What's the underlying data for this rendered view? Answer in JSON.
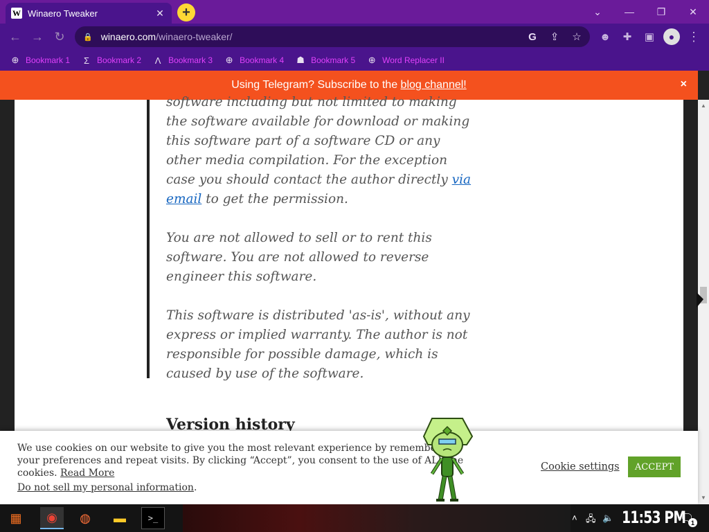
{
  "browser": {
    "tab": {
      "favicon": "W",
      "title": "Winaero Tweaker",
      "close": "✕"
    },
    "new_tab": "+",
    "window_controls": {
      "tab_search": "⌄",
      "minimize": "—",
      "restore": "❐",
      "close": "✕"
    },
    "nav": {
      "back": "←",
      "forward": "→",
      "reload": "↻"
    },
    "address": {
      "lock": "🔒",
      "host": "winaero.com",
      "path": "/winaero-tweaker/"
    },
    "omni_icons": {
      "google": "G",
      "share": "⇪",
      "bookmark": "☆"
    },
    "toolbar_icons": {
      "extension_avatar": "☻",
      "extensions": "✚",
      "side_panel": "▣",
      "profile": "●",
      "menu": "⋮"
    }
  },
  "bookmarks": [
    {
      "label": "Bookmark 1",
      "icon": "⊕"
    },
    {
      "label": "Bookmark 2",
      "icon": "Σ"
    },
    {
      "label": "Bookmark 3",
      "icon": "Λ"
    },
    {
      "label": "Bookmark 4",
      "icon": "⊕"
    },
    {
      "label": "Bookmark 5",
      "icon": "☗"
    },
    {
      "label": "Word Replacer II",
      "icon": "⊕"
    }
  ],
  "banner": {
    "text": "Using Telegram? Subscribe to the ",
    "link": "blog channel!",
    "close": "×",
    "color": "#f4511e"
  },
  "article": {
    "p1_prefix": "software including but not limited to making the software available for download or making this software part of a software CD or any other media compilation. For the exception case you should contact the author directly ",
    "p1_link": "via email",
    "p1_suffix": " to get the permission.",
    "p2": "You are not allowed to sell or to rent this software. You are not allowed to reverse engineer this software.",
    "p3": "This software is distributed 'as-is', without any express or implied warranty. The author is not responsible for possible damage, which is caused by use of the software.",
    "heading": "Version history"
  },
  "cookie": {
    "text": "We use cookies on our website to give you the most relevant experience by remembering your preferences and repeat visits. By clicking “Accept”, you consent to the use of ALL the cookies. ",
    "read_more": "Read More",
    "do_not_sell": "Do not sell my personal information",
    "do_not_sell_suffix": ".",
    "settings": "Cookie settings",
    "accept": "ACCEPT",
    "accept_color": "#61a229"
  },
  "taskbar": {
    "apps": [
      {
        "name": "start-icon",
        "glyph": "▦"
      },
      {
        "name": "chrome-icon",
        "glyph": "◉"
      },
      {
        "name": "firefox-icon",
        "glyph": "◍"
      },
      {
        "name": "file-explorer-icon",
        "glyph": "▬"
      },
      {
        "name": "terminal-icon",
        "glyph": ">_"
      }
    ],
    "tray": {
      "overflow": "˄",
      "network": "🖧",
      "volume": "🔈"
    },
    "clock": "11:53 PM",
    "notifications": "🗨",
    "notification_count": "1"
  }
}
